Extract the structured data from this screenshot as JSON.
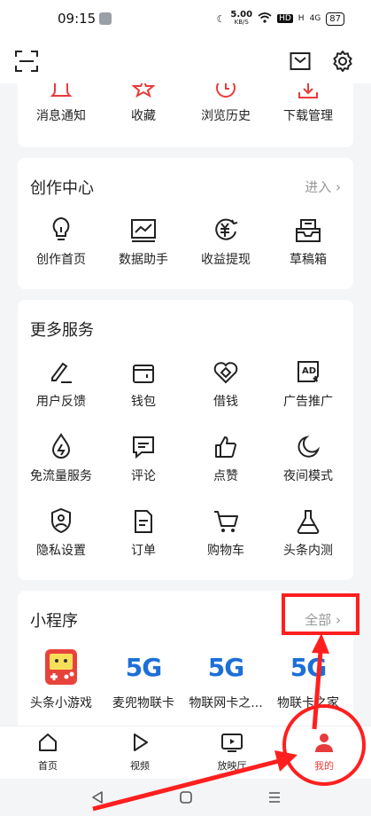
{
  "status": {
    "time": "09:15",
    "net": "5.00",
    "net_unit": "KB/S",
    "hd": "HD",
    "sig1": "H",
    "sig2": "4G",
    "battery": "87"
  },
  "top_section": {
    "items": [
      {
        "label": "消息通知"
      },
      {
        "label": "收藏"
      },
      {
        "label": "浏览历史"
      },
      {
        "label": "下载管理"
      }
    ]
  },
  "creation": {
    "title": "创作中心",
    "more": "进入 ›",
    "items": [
      {
        "label": "创作首页"
      },
      {
        "label": "数据助手"
      },
      {
        "label": "收益提现"
      },
      {
        "label": "草稿箱"
      }
    ]
  },
  "services": {
    "title": "更多服务",
    "items": [
      {
        "label": "用户反馈"
      },
      {
        "label": "钱包"
      },
      {
        "label": "借钱"
      },
      {
        "label": "广告推广"
      },
      {
        "label": "免流量服务"
      },
      {
        "label": "评论"
      },
      {
        "label": "点赞"
      },
      {
        "label": "夜间模式"
      },
      {
        "label": "隐私设置"
      },
      {
        "label": "订单"
      },
      {
        "label": "购物车"
      },
      {
        "label": "头条内测"
      }
    ]
  },
  "mini": {
    "title": "小程序",
    "more": "全部 ›",
    "fiveg_text": "5G",
    "ad_text": "AD",
    "items": [
      {
        "label": "头条小游戏"
      },
      {
        "label": "麦兜物联卡"
      },
      {
        "label": "物联网卡之..."
      },
      {
        "label": "物联卡之家"
      }
    ]
  },
  "nav": {
    "items": [
      {
        "label": "首页"
      },
      {
        "label": "视频"
      },
      {
        "label": "放映厅"
      },
      {
        "label": "我的"
      }
    ]
  },
  "colors": {
    "accent": "#e83a3a",
    "annotation": "#ff1f1f",
    "fiveg": "#1c6fd8"
  }
}
